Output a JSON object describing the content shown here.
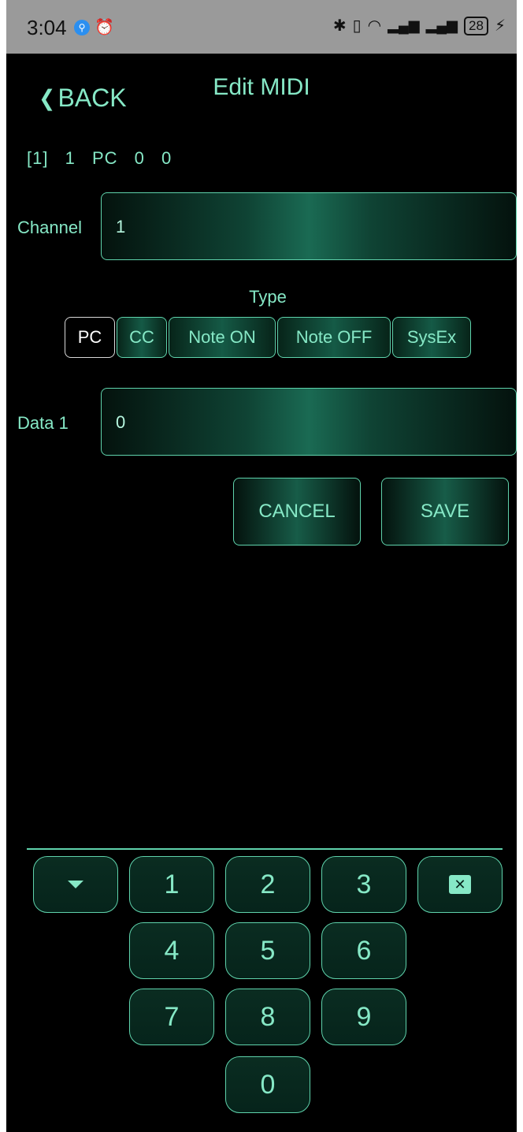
{
  "status_bar": {
    "time": "3:04",
    "battery": "28",
    "icons": [
      "search-dot-icon",
      "alarm-icon",
      "bluetooth-icon",
      "vibrate-icon",
      "wifi-icon",
      "signal-4g-icon",
      "signal-4g-icon",
      "charging-icon"
    ]
  },
  "header": {
    "back_label": "BACK",
    "title": "Edit MIDI"
  },
  "summary": {
    "index": "[1]",
    "channel": "1",
    "type": "PC",
    "data1": "0",
    "data2": "0"
  },
  "channel_field": {
    "label": "Channel",
    "value": "1"
  },
  "type_selector": {
    "label": "Type",
    "options": [
      "PC",
      "CC",
      "Note ON",
      "Note OFF",
      "SysEx"
    ],
    "selected": "PC"
  },
  "data1_field": {
    "label": "Data 1",
    "value": "0"
  },
  "actions": {
    "cancel_label": "CANCEL",
    "save_label": "SAVE"
  },
  "keypad": {
    "keys": [
      "1",
      "2",
      "3",
      "4",
      "5",
      "6",
      "7",
      "8",
      "9",
      "0"
    ],
    "hide_icon": "chevron-down-icon",
    "backspace_icon": "backspace-icon"
  },
  "colors": {
    "accent": "#86e8c6",
    "border": "#5fd3ac",
    "background": "#000000"
  }
}
